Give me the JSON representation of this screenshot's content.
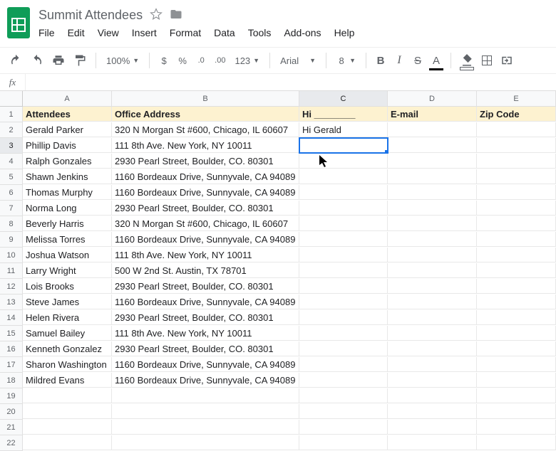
{
  "doc": {
    "title": "Summit Attendees"
  },
  "menu": {
    "file": "File",
    "edit": "Edit",
    "view": "View",
    "insert": "Insert",
    "format": "Format",
    "data": "Data",
    "tools": "Tools",
    "addons": "Add-ons",
    "help": "Help"
  },
  "toolbar": {
    "zoom": "100%",
    "dollar": "$",
    "percent": "%",
    "dec_less": ".0←",
    "dec_more": ".00→",
    "num_format": "123",
    "font": "Arial",
    "font_size": "8",
    "bold": "B",
    "italic": "I",
    "strike": "S",
    "textcolor": "A"
  },
  "formula_bar": {
    "fx_label": "fx",
    "value": ""
  },
  "columns": [
    "A",
    "B",
    "C",
    "D",
    "E"
  ],
  "headers": {
    "A": "Attendees",
    "B": "Office Address",
    "C": "Hi ________",
    "D": "E-mail",
    "E": "Zip Code"
  },
  "rows": [
    {
      "n": "1"
    },
    {
      "n": "2",
      "A": "Gerald Parker",
      "B": "320 N Morgan St #600, Chicago, IL 60607",
      "C": "Hi Gerald"
    },
    {
      "n": "3",
      "A": "Phillip Davis",
      "B": "111 8th Ave. New York, NY 10011"
    },
    {
      "n": "4",
      "A": "Ralph Gonzales",
      "B": "2930 Pearl Street, Boulder, CO. 80301"
    },
    {
      "n": "5",
      "A": "Shawn Jenkins",
      "B": "1160 Bordeaux Drive, Sunnyvale, CA 94089"
    },
    {
      "n": "6",
      "A": "Thomas Murphy",
      "B": "1160 Bordeaux Drive, Sunnyvale, CA 94089"
    },
    {
      "n": "7",
      "A": "Norma Long",
      "B": "2930 Pearl Street, Boulder, CO. 80301"
    },
    {
      "n": "8",
      "A": "Beverly Harris",
      "B": "320 N Morgan St #600, Chicago, IL 60607"
    },
    {
      "n": "9",
      "A": "Melissa Torres",
      "B": "1160 Bordeaux Drive, Sunnyvale, CA 94089"
    },
    {
      "n": "10",
      "A": "Joshua Watson",
      "B": "111 8th Ave. New York, NY 10011"
    },
    {
      "n": "11",
      "A": "Larry Wright",
      "B": "500 W 2nd St. Austin, TX 78701"
    },
    {
      "n": "12",
      "A": "Lois Brooks",
      "B": "2930 Pearl Street, Boulder, CO. 80301"
    },
    {
      "n": "13",
      "A": "Steve James",
      "B": "1160 Bordeaux Drive, Sunnyvale, CA 94089"
    },
    {
      "n": "14",
      "A": "Helen Rivera",
      "B": "2930 Pearl Street, Boulder, CO. 80301"
    },
    {
      "n": "15",
      "A": "Samuel Bailey",
      "B": "111 8th Ave. New York, NY 10011"
    },
    {
      "n": "16",
      "A": "Kenneth Gonzalez",
      "B": "2930 Pearl Street, Boulder, CO. 80301"
    },
    {
      "n": "17",
      "A": "Sharon Washington",
      "B": "1160 Bordeaux Drive, Sunnyvale, CA 94089"
    },
    {
      "n": "18",
      "A": "Mildred Evans",
      "B": "1160 Bordeaux Drive, Sunnyvale, CA 94089"
    },
    {
      "n": "19"
    },
    {
      "n": "20"
    },
    {
      "n": "21"
    },
    {
      "n": "22"
    }
  ],
  "selected": {
    "row": "3",
    "col": "C"
  }
}
